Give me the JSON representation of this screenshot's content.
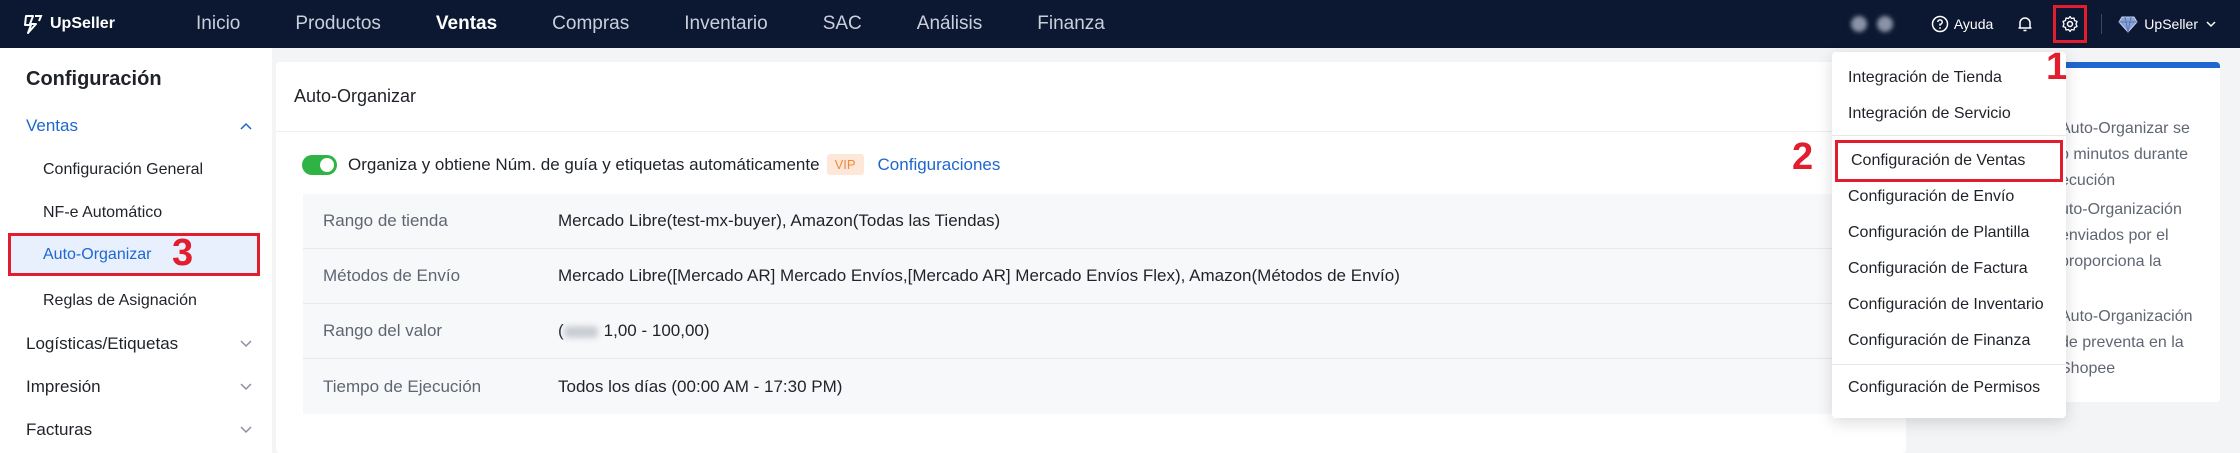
{
  "app": {
    "logo": "UpSeller"
  },
  "nav": {
    "items": [
      {
        "label": "Inicio",
        "active": false
      },
      {
        "label": "Productos",
        "active": false
      },
      {
        "label": "Ventas",
        "active": true
      },
      {
        "label": "Compras",
        "active": false
      },
      {
        "label": "Inventario",
        "active": false
      },
      {
        "label": "SAC",
        "active": false
      },
      {
        "label": "Análisis",
        "active": false
      },
      {
        "label": "Finanza",
        "active": false
      }
    ],
    "help": "Ayuda",
    "user": "UpSeller"
  },
  "sidebar": {
    "title": "Configuración",
    "ventas": "Ventas",
    "ventas_items": [
      "Configuración General",
      "NF-e Automático",
      "Auto-Organizar",
      "Reglas de Asignación"
    ],
    "logisticas": "Logísticas/Etiquetas",
    "impresion": "Impresión",
    "facturas": "Facturas"
  },
  "main": {
    "title": "Auto-Organizar",
    "toggle_text": "Organiza y obtiene Núm. de guía y etiquetas automáticamente",
    "toggle_on": true,
    "vip": "VIP",
    "config_link": "Configuraciones",
    "rules": [
      {
        "label": "Rango de tienda",
        "value": "Mercado Libre(test-mx-buyer), Amazon(Todas las Tiendas)"
      },
      {
        "label": "Métodos de Envío",
        "value": "Mercado Libre([Mercado AR] Mercado Envíos,[Mercado AR] Mercado Envíos Flex), Amazon(Métodos de Envío)"
      },
      {
        "label": "Rango del valor",
        "value_prefix": "(",
        "value": "1,00 - 100,00)"
      },
      {
        "label": "Tiempo de Ejecución",
        "value": "Todos los días (00:00 AM - 17:30 PM)"
      }
    ]
  },
  "right_panel": {
    "p1": [
      "Auto-Organizar se",
      "o minutos durante",
      "ecución"
    ],
    "p2": [
      "uto-Organización",
      "enviados por el",
      "proporciona la"
    ],
    "p3": [
      "Auto-Organización",
      "de preventa en la",
      "Shopee"
    ]
  },
  "dropdown": {
    "items": [
      "Integración de Tienda",
      "Integración de Servicio",
      "Configuración de Ventas",
      "Configuración de Envío",
      "Configuración de Plantilla",
      "Configuración de Factura",
      "Configuración de Inventario",
      "Configuración de Finanza",
      "Configuración de Permisos"
    ]
  },
  "annotations": {
    "one": "1",
    "two": "2",
    "three": "3",
    "color": "#e11d2e"
  },
  "colors": {
    "topbar": "#0c1831",
    "accent": "#1e66d0",
    "toggle": "#2fb344",
    "highlight": "#e11d2e"
  }
}
